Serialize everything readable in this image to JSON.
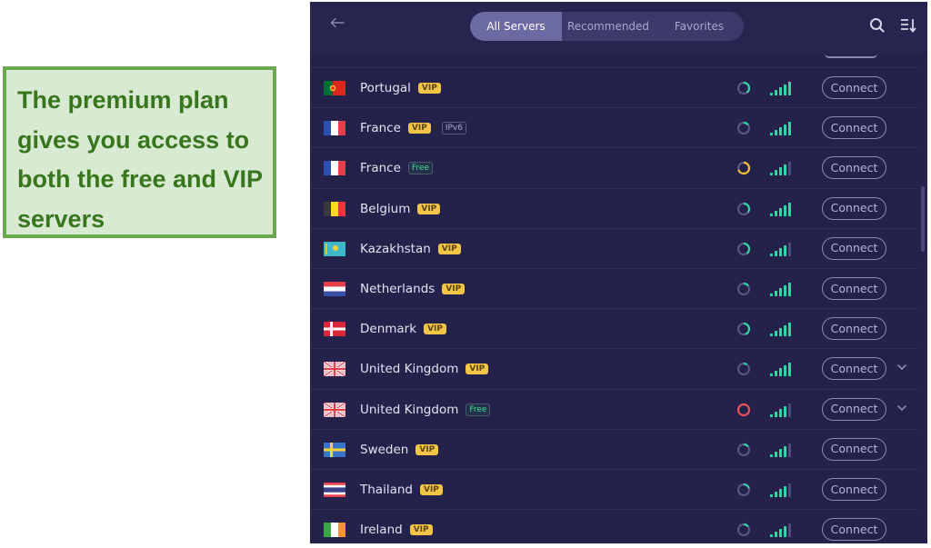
{
  "callout": {
    "text": "The premium plan gives you access to both the free and VIP servers"
  },
  "header": {
    "back_icon": "arrow-left-icon",
    "tabs": [
      {
        "label": "All Servers",
        "active": true
      },
      {
        "label": "Recommended",
        "active": false
      },
      {
        "label": "Favorites",
        "active": false
      }
    ],
    "search_icon": "search-icon",
    "sort_icon": "sort-icon"
  },
  "colors": {
    "app_bg": "#24224a",
    "accent_green": "#2ed8a3",
    "vip_yellow": "#f3c546",
    "load_yellow": "#f1c232",
    "load_red": "#e8505b",
    "callout_bg": "#d9ead3",
    "callout_border": "#6aa84f",
    "callout_text": "#38761d"
  },
  "servers": [
    {
      "country": "Portugal",
      "flag": "pt",
      "badges": [
        "VIP"
      ],
      "load": 0.4,
      "load_level": "normal",
      "signal": 5,
      "action": "Connect",
      "expandable": false
    },
    {
      "country": "France",
      "flag": "fr",
      "badges": [
        "VIP",
        "IPv6"
      ],
      "load": 0.15,
      "load_level": "normal",
      "signal": 5,
      "action": "Connect",
      "expandable": false
    },
    {
      "country": "France",
      "flag": "fr",
      "badges": [
        "Free"
      ],
      "load": 0.7,
      "load_level": "medium",
      "signal": 4,
      "action": "Connect",
      "expandable": false
    },
    {
      "country": "Belgium",
      "flag": "be",
      "badges": [
        "VIP"
      ],
      "load": 0.35,
      "load_level": "normal",
      "signal": 5,
      "action": "Connect",
      "expandable": false
    },
    {
      "country": "Kazakhstan",
      "flag": "kz",
      "badges": [
        "VIP"
      ],
      "load": 0.4,
      "load_level": "normal",
      "signal": 4,
      "action": "Connect",
      "expandable": false
    },
    {
      "country": "Netherlands",
      "flag": "nl",
      "badges": [
        "VIP"
      ],
      "load": 0.15,
      "load_level": "normal",
      "signal": 5,
      "action": "Connect",
      "expandable": false
    },
    {
      "country": "Denmark",
      "flag": "dk",
      "badges": [
        "VIP"
      ],
      "load": 0.45,
      "load_level": "normal",
      "signal": 5,
      "action": "Connect",
      "expandable": false
    },
    {
      "country": "United Kingdom",
      "flag": "gb",
      "badges": [
        "VIP"
      ],
      "load": 0.1,
      "load_level": "normal",
      "signal": 5,
      "action": "Connect",
      "expandable": true
    },
    {
      "country": "United Kingdom",
      "flag": "gb",
      "badges": [
        "Free"
      ],
      "load": 1.0,
      "load_level": "high",
      "signal": 4,
      "action": "Connect",
      "expandable": true
    },
    {
      "country": "Sweden",
      "flag": "se",
      "badges": [
        "VIP"
      ],
      "load": 0.15,
      "load_level": "normal",
      "signal": 4,
      "action": "Connect",
      "expandable": false
    },
    {
      "country": "Thailand",
      "flag": "th",
      "badges": [
        "VIP"
      ],
      "load": 0.2,
      "load_level": "normal",
      "signal": 4,
      "action": "Connect",
      "expandable": false
    },
    {
      "country": "Ireland",
      "flag": "ie",
      "badges": [
        "VIP"
      ],
      "load": 0.15,
      "load_level": "normal",
      "signal": 4,
      "action": "Connect",
      "expandable": false
    }
  ]
}
